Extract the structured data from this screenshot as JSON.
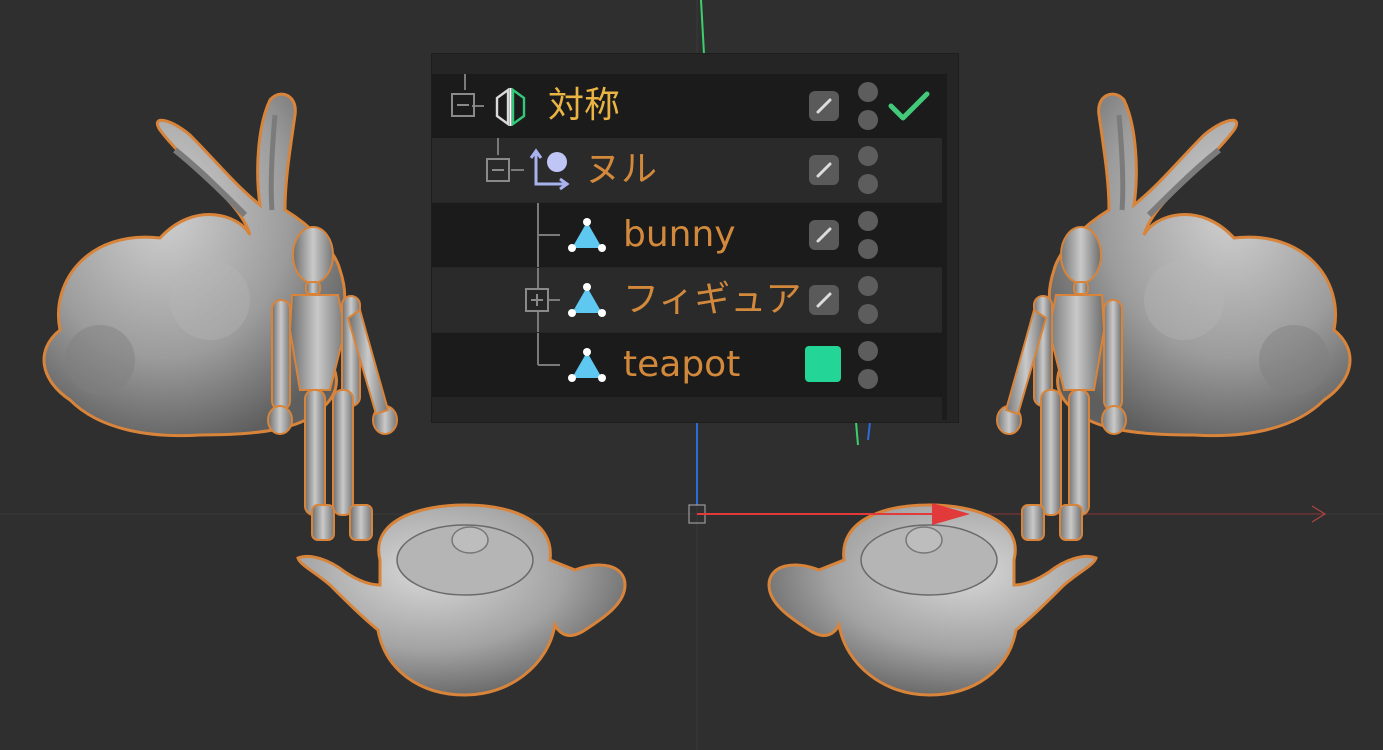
{
  "viewport": {
    "background_color": "#2f2f2f",
    "axis_x_color": "#e23a3a",
    "axis_y_color": "#2f6bd8",
    "axis_z_color": "#3ad06b",
    "selection_outline_color": "#d8843a",
    "model_color": "#9a9a9a"
  },
  "object_manager": {
    "objects": [
      {
        "name": "対称",
        "icon": "symmetry-icon",
        "name_color": "#e9b443",
        "tree": "collapse",
        "tag": "edit-tag",
        "enabled": true
      },
      {
        "name": "ヌル",
        "icon": "null-object-icon",
        "name_color": "#d2893c",
        "tree": "collapse",
        "tag": "edit-tag"
      },
      {
        "name": "bunny",
        "icon": "polygon-object-icon",
        "name_color": "#d2893c",
        "tree": "branch",
        "tag": "edit-tag"
      },
      {
        "name": "フィギュア",
        "icon": "polygon-object-icon",
        "name_color": "#d2893c",
        "tree": "expand",
        "tag": "edit-tag"
      },
      {
        "name": "teapot",
        "icon": "polygon-object-icon",
        "name_color": "#d2893c",
        "tree": "branch-end",
        "tag": "color-swatch",
        "swatch_color": "#23d597"
      }
    ],
    "enabled_check_color": "#43c97a",
    "visibility_dot_color": "#5d5d5d"
  }
}
